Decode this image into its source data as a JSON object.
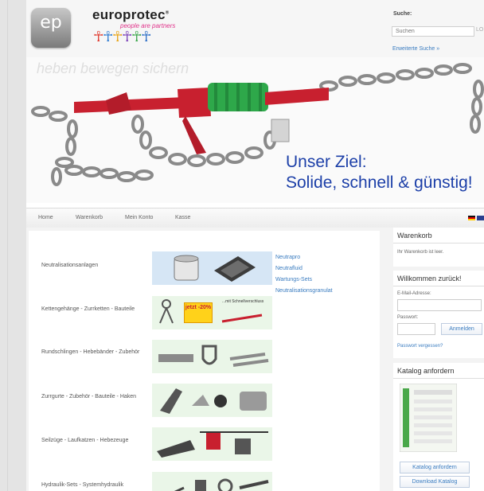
{
  "header": {
    "logo_text": "ep",
    "brand": "europrotec",
    "brand_reg": "®",
    "tagline": "people are partners",
    "search_label": "Suche:",
    "search_placeholder": "Suchen",
    "search_button": "LO",
    "advanced_search": "Erweiterte Suche »"
  },
  "banner": {
    "slogan": "heben bewegen sichern",
    "headline_1": "Unser Ziel:",
    "headline_2": "Solide, schnell & günstig!"
  },
  "nav": {
    "items": [
      "Home",
      "Warenkorb",
      "Mein Konto",
      "Kasse"
    ]
  },
  "categories": [
    {
      "label": "Neutralisationsanlagen",
      "links": [
        "Neutrapro",
        "Neutrafluid",
        "Wartungs-Sets",
        "Neutralisationsgranulat"
      ]
    },
    {
      "label": "Kettengehänge - Zurrketten - Bauteile",
      "badge": "jetzt -20%",
      "badge_caption": "...mit Schnellverschluss"
    },
    {
      "label": "Rundschlingen - Hebebänder - Zubehör"
    },
    {
      "label": "Zurrgurte - Zubehör - Bauteile - Haken"
    },
    {
      "label": "Seilzüge - Laufkatzen - Hebezeuge"
    },
    {
      "label": "Hydraulik-Sets - Systemhydraulik"
    }
  ],
  "sidebar": {
    "cart": {
      "title": "Warenkorb",
      "text": "Ihr Warenkorb ist leer."
    },
    "login": {
      "title": "Willkommen zurück!",
      "email_label": "E-Mail-Adresse:",
      "password_label": "Passwort:",
      "login_button": "Anmelden",
      "forgot": "Passwort vergessen?"
    },
    "catalog": {
      "title": "Katalog anfordern",
      "request_button": "Katalog anfordern",
      "download_button": "Download Katalog"
    }
  },
  "colors": {
    "accent": "#3a7cc0",
    "banner_text": "#1c3fa8",
    "hook": "#c8202f",
    "sleeve": "#2ea84a"
  }
}
